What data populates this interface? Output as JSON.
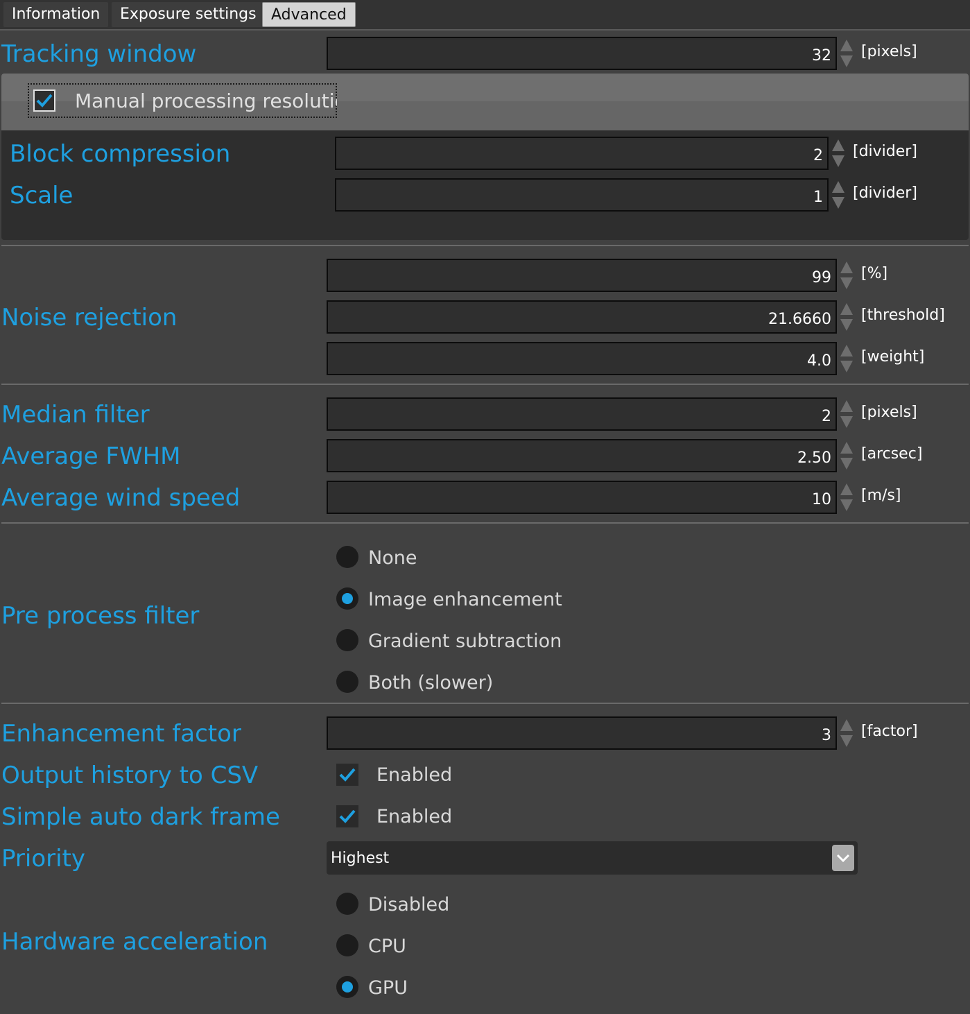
{
  "tabs": [
    "Information",
    "Exposure settings",
    "Advanced"
  ],
  "tracking_window": {
    "label": "Tracking window",
    "value": "32",
    "unit": "[pixels]"
  },
  "manual_processing": {
    "label": "Manual processing resolution",
    "checked": true
  },
  "block_compression": {
    "label": "Block compression",
    "value": "2",
    "unit": "[divider]"
  },
  "scale": {
    "label": "Scale",
    "value": "1",
    "unit": "[divider]"
  },
  "noise_rejection": {
    "label": "Noise rejection",
    "fields": [
      {
        "value": "99",
        "unit": "[%]"
      },
      {
        "value": "21.6660",
        "unit": "[threshold]"
      },
      {
        "value": "4.0",
        "unit": "[weight]"
      }
    ]
  },
  "median_filter": {
    "label": "Median filter",
    "value": "2",
    "unit": "[pixels]"
  },
  "average_fwhm": {
    "label": "Average FWHM",
    "value": "2.50",
    "unit": "[arcsec]"
  },
  "average_wind_speed": {
    "label": "Average wind speed",
    "value": "10",
    "unit": "[m/s]"
  },
  "pre_process_filter": {
    "label": "Pre process filter",
    "options": [
      "None",
      "Image enhancement",
      "Gradient subtraction",
      "Both (slower)"
    ],
    "selected": "Image enhancement"
  },
  "enhancement_factor": {
    "label": "Enhancement factor",
    "value": "3",
    "unit": "[factor]"
  },
  "output_history": {
    "label": "Output history to CSV",
    "checkbox_label": "Enabled",
    "checked": true
  },
  "auto_dark_frame": {
    "label": "Simple auto dark frame",
    "checkbox_label": "Enabled",
    "checked": true
  },
  "priority": {
    "label": "Priority",
    "value": "Highest"
  },
  "hardware_acceleration": {
    "label": "Hardware acceleration",
    "options": [
      "Disabled",
      "CPU",
      "GPU"
    ],
    "selected": "GPU"
  },
  "colors": {
    "accent": "#1ea0e0",
    "background": "#414141",
    "field": "#2f2f2f"
  }
}
